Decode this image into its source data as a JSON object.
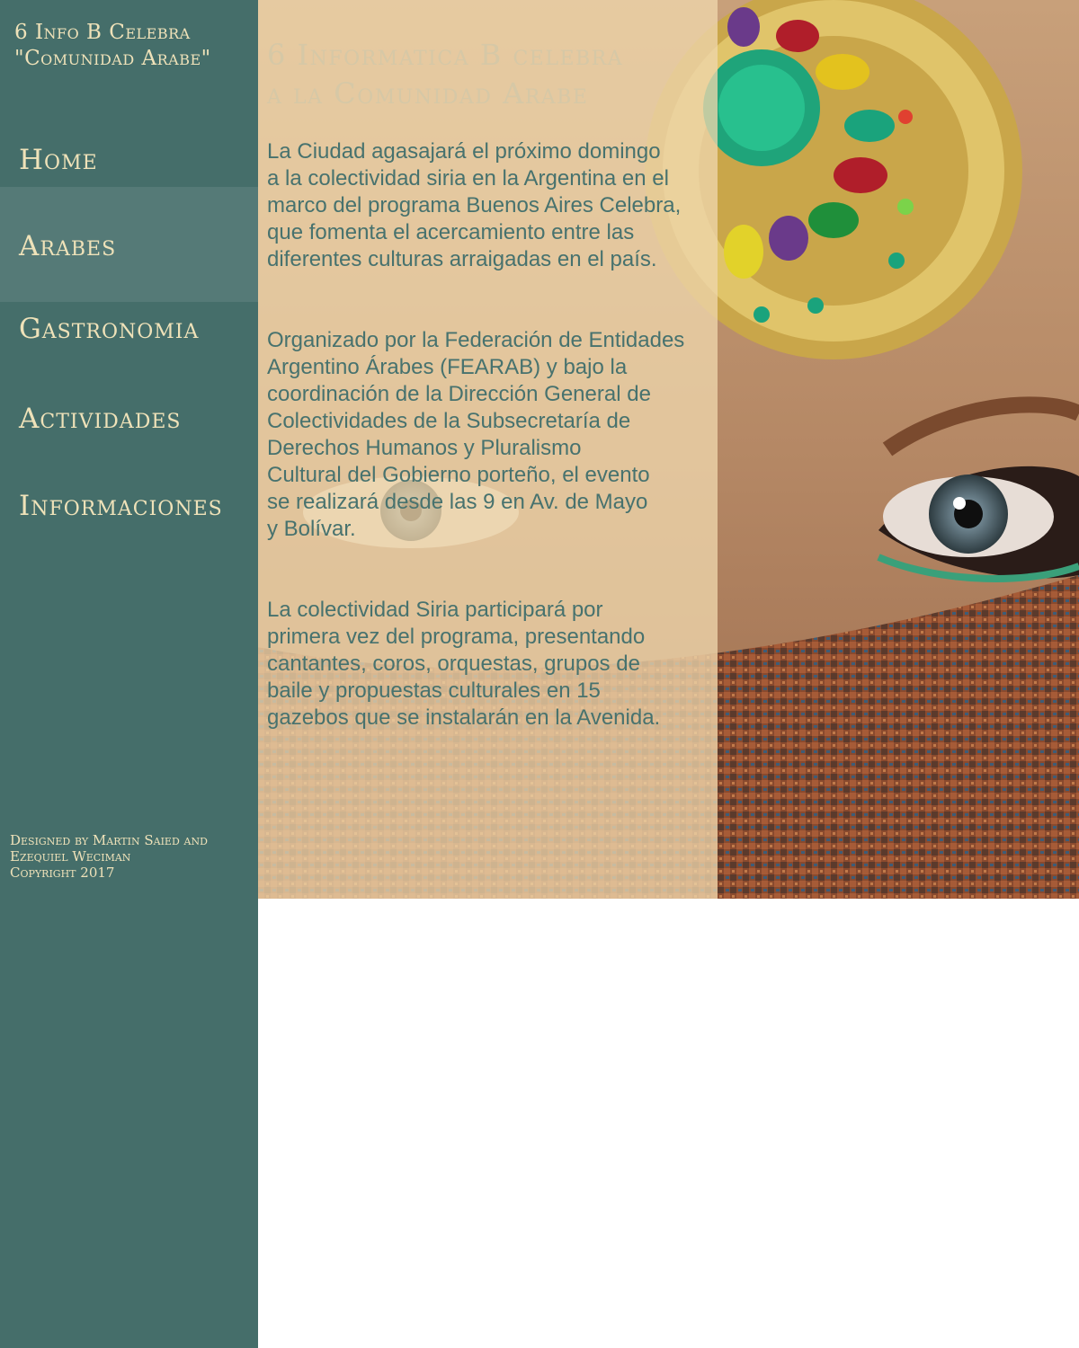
{
  "site": {
    "title_line1": "6 Info B Celebra",
    "title_line2": "\"Comunidad Arabe\""
  },
  "nav": {
    "items": [
      {
        "label": "Home",
        "active": false
      },
      {
        "label": "Arabes",
        "active": true
      },
      {
        "label": "Gastronomia",
        "active": false
      },
      {
        "label": "Actividades",
        "active": false
      },
      {
        "label": "Informaciones",
        "active": false
      }
    ]
  },
  "footer": {
    "line1": "Designed by Martin Saied and",
    "line2": "Ezequiel Weciman",
    "line3": "Copyright 2017"
  },
  "article": {
    "title_line1": "6 Informatica B celebra",
    "title_line2": "a la Comunidad Arabe",
    "paragraphs": [
      "La Ciudad agasajará el próximo domingo\na la colectividad siria en la Argentina en el\nmarco del programa Buenos Aires Celebra,\nque fomenta el acercamiento entre las\ndiferentes culturas arraigadas en el país.",
      "Organizado por la Federación de Entidades\nArgentino Árabes (FEARAB) y bajo la\ncoordinación de la Dirección General de\nColectividades de la Subsecretaría de\nDerechos Humanos y Pluralismo\nCultural del Gobierno porteño, el evento\n se realizará desde las 9 en Av. de Mayo\ny Bolívar.",
      "La colectividad Siria participará por\nprimera vez del programa, presentando\ncantantes, coros, orquestas, grupos de\nbaile y propuestas culturales en 15\ngazebos que se instalarán en la Avenida."
    ]
  },
  "colors": {
    "sidebar": "#456e6a",
    "sidebar_active": "#557a77",
    "nav_text": "#efe2b9",
    "body_text": "#47726e",
    "title_text": "#d6c8a6"
  },
  "hero_image": {
    "icon": "woman-face-jewel-photo"
  }
}
